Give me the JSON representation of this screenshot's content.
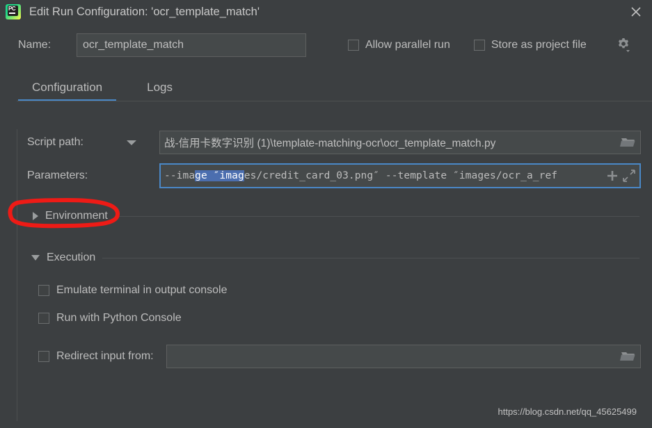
{
  "window": {
    "title": "Edit Run Configuration: 'ocr_template_match'",
    "logo_icon": "pycharm-logo-icon",
    "close_icon": "close-icon",
    "accent_color": "#4a88c7",
    "background_color": "#3c3f41"
  },
  "name_row": {
    "label": "Name:",
    "value": "ocr_template_match",
    "placeholder": ""
  },
  "top_checkboxes": [
    {
      "label": "Allow parallel run",
      "checked": false
    },
    {
      "label": "Store as project file",
      "checked": false
    }
  ],
  "gear": {
    "icon": "gear-dropdown-icon"
  },
  "tabs": [
    {
      "label": "Configuration",
      "active": true
    },
    {
      "label": "Logs",
      "active": false
    }
  ],
  "fields": {
    "script_path": {
      "label": "Script path:",
      "dropdown_icon": "chevron-down-icon",
      "value": "战-信用卡数字识别 (1)\\template-matching-ocr\\ocr_template_match.py",
      "browse_icon": "folder-icon"
    },
    "parameters": {
      "label": "Parameters:",
      "value_before_selection": "--ima",
      "value_selected": "ge ″imag",
      "value_after_selection": "es/credit_card_03.png″ --template ″images/ocr_a_ref",
      "full_value": "--image ″images/credit_card_03.png″ --template ″images/ocr_a_ref",
      "selection_color": "#4b6eaf",
      "focused": true,
      "insert_macro_icon": "plus-icon",
      "expand_icon": "expand-arrows-icon"
    }
  },
  "sections": [
    {
      "title": "Environment",
      "expanded": false,
      "toggle_icon": "triangle-right-icon"
    },
    {
      "title": "Execution",
      "expanded": true,
      "toggle_icon": "triangle-down-icon"
    }
  ],
  "execution_checkboxes": [
    {
      "label": "Emulate terminal in output console",
      "checked": false
    },
    {
      "label": "Run with Python Console",
      "checked": false
    }
  ],
  "redirect": {
    "label": "Redirect input from:",
    "checked": false,
    "value": "",
    "browse_icon": "folder-icon"
  },
  "annotation": {
    "shape": "red-ellipse-highlight",
    "color": "#ee1b16",
    "target": "Parameters:"
  },
  "watermark": {
    "text": "https://blog.csdn.net/qq_45625499"
  }
}
